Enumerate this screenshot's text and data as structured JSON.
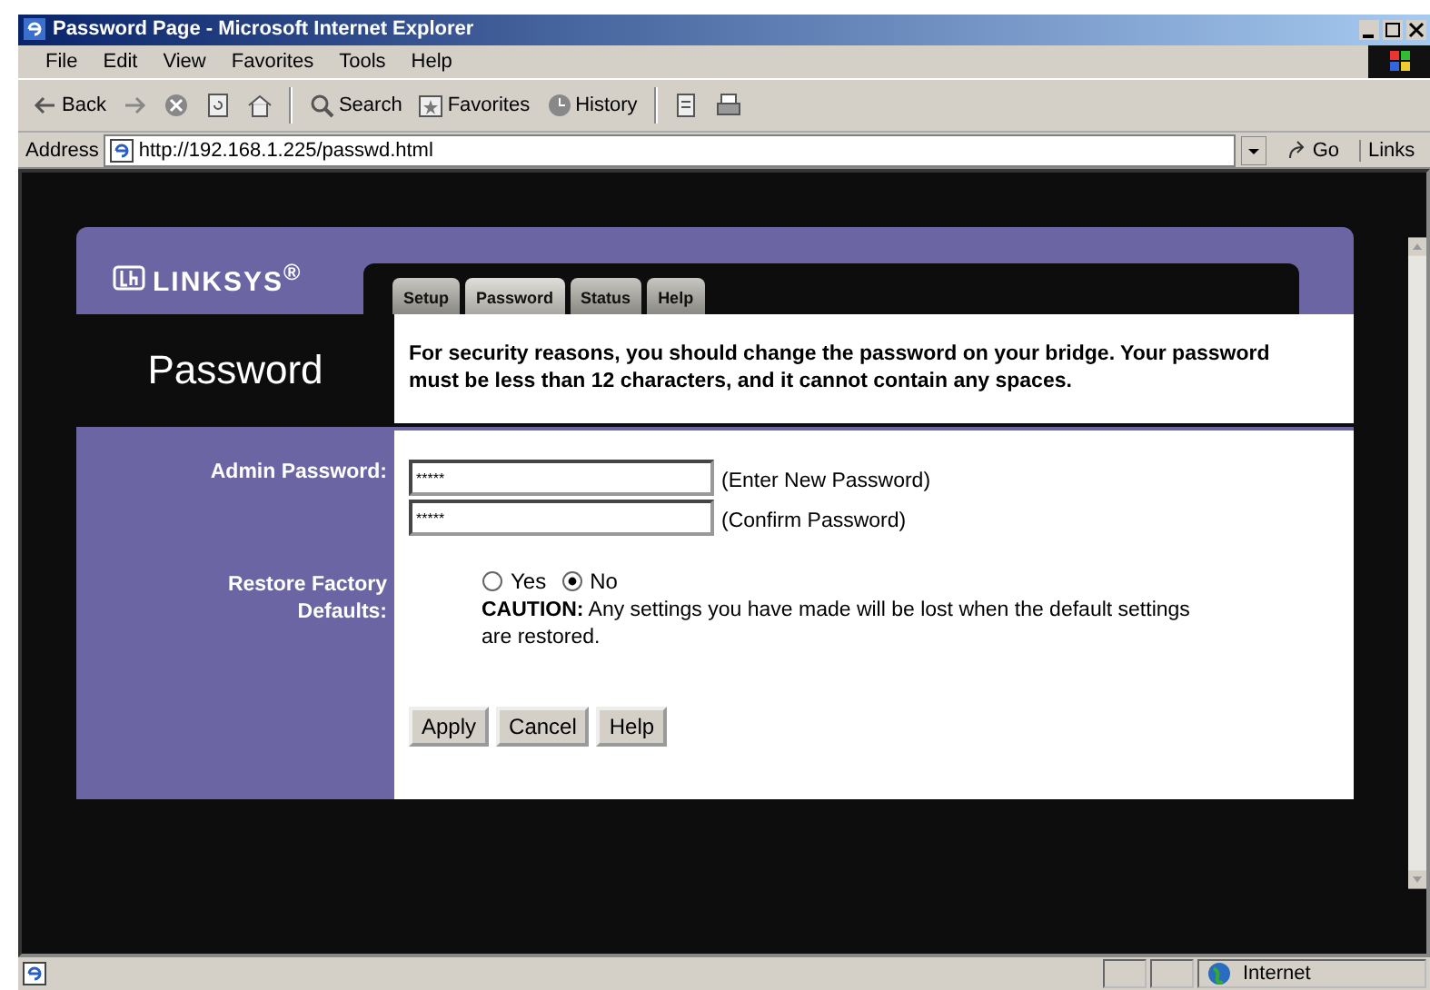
{
  "window": {
    "title": "Password Page - Microsoft Internet Explorer"
  },
  "menu": [
    "File",
    "Edit",
    "View",
    "Favorites",
    "Tools",
    "Help"
  ],
  "toolbar": [
    {
      "kind": "back",
      "label": "Back"
    },
    {
      "kind": "forward"
    },
    {
      "kind": "stop"
    },
    {
      "kind": "refresh"
    },
    {
      "kind": "home"
    },
    {
      "kind": "search",
      "label": "Search"
    },
    {
      "kind": "favorites",
      "label": "Favorites"
    },
    {
      "kind": "history",
      "label": "History"
    },
    {
      "kind": "edit"
    },
    {
      "kind": "print"
    }
  ],
  "address": {
    "label": "Address",
    "url": "http://192.168.1.225/passwd.html",
    "go": "Go",
    "links": "Links"
  },
  "page": {
    "logo": "LINKSYS$^{®}$",
    "heading": "Password",
    "tabs": [
      {
        "label": "Setup",
        "selected": false
      },
      {
        "label": "Password",
        "selected": true
      },
      {
        "label": "Status",
        "selected": false
      },
      {
        "label": "Help",
        "selected": false
      }
    ],
    "intro": "For security reasons, you should change the password on your bridge. Your password must be less than 12 characters, and it cannot contain any spaces.",
    "admin": {
      "label": "Admin Password:",
      "fields": [
        {
          "value": "*****",
          "hint": "(Enter New Password)"
        },
        {
          "value": "*****",
          "hint": "(Confirm Password)"
        }
      ]
    },
    "restore": {
      "label": "Restore Factory Defaults:",
      "options": [
        {
          "label": "Yes",
          "selected": false
        },
        {
          "label": "No",
          "selected": true
        }
      ],
      "caution": "**CAUTION:**  Any settings you have made will be lost when the default settings are restored."
    },
    "buttons": [
      "Apply",
      "Cancel",
      "Help"
    ]
  },
  "status_bar": {
    "zone": "Internet"
  }
}
